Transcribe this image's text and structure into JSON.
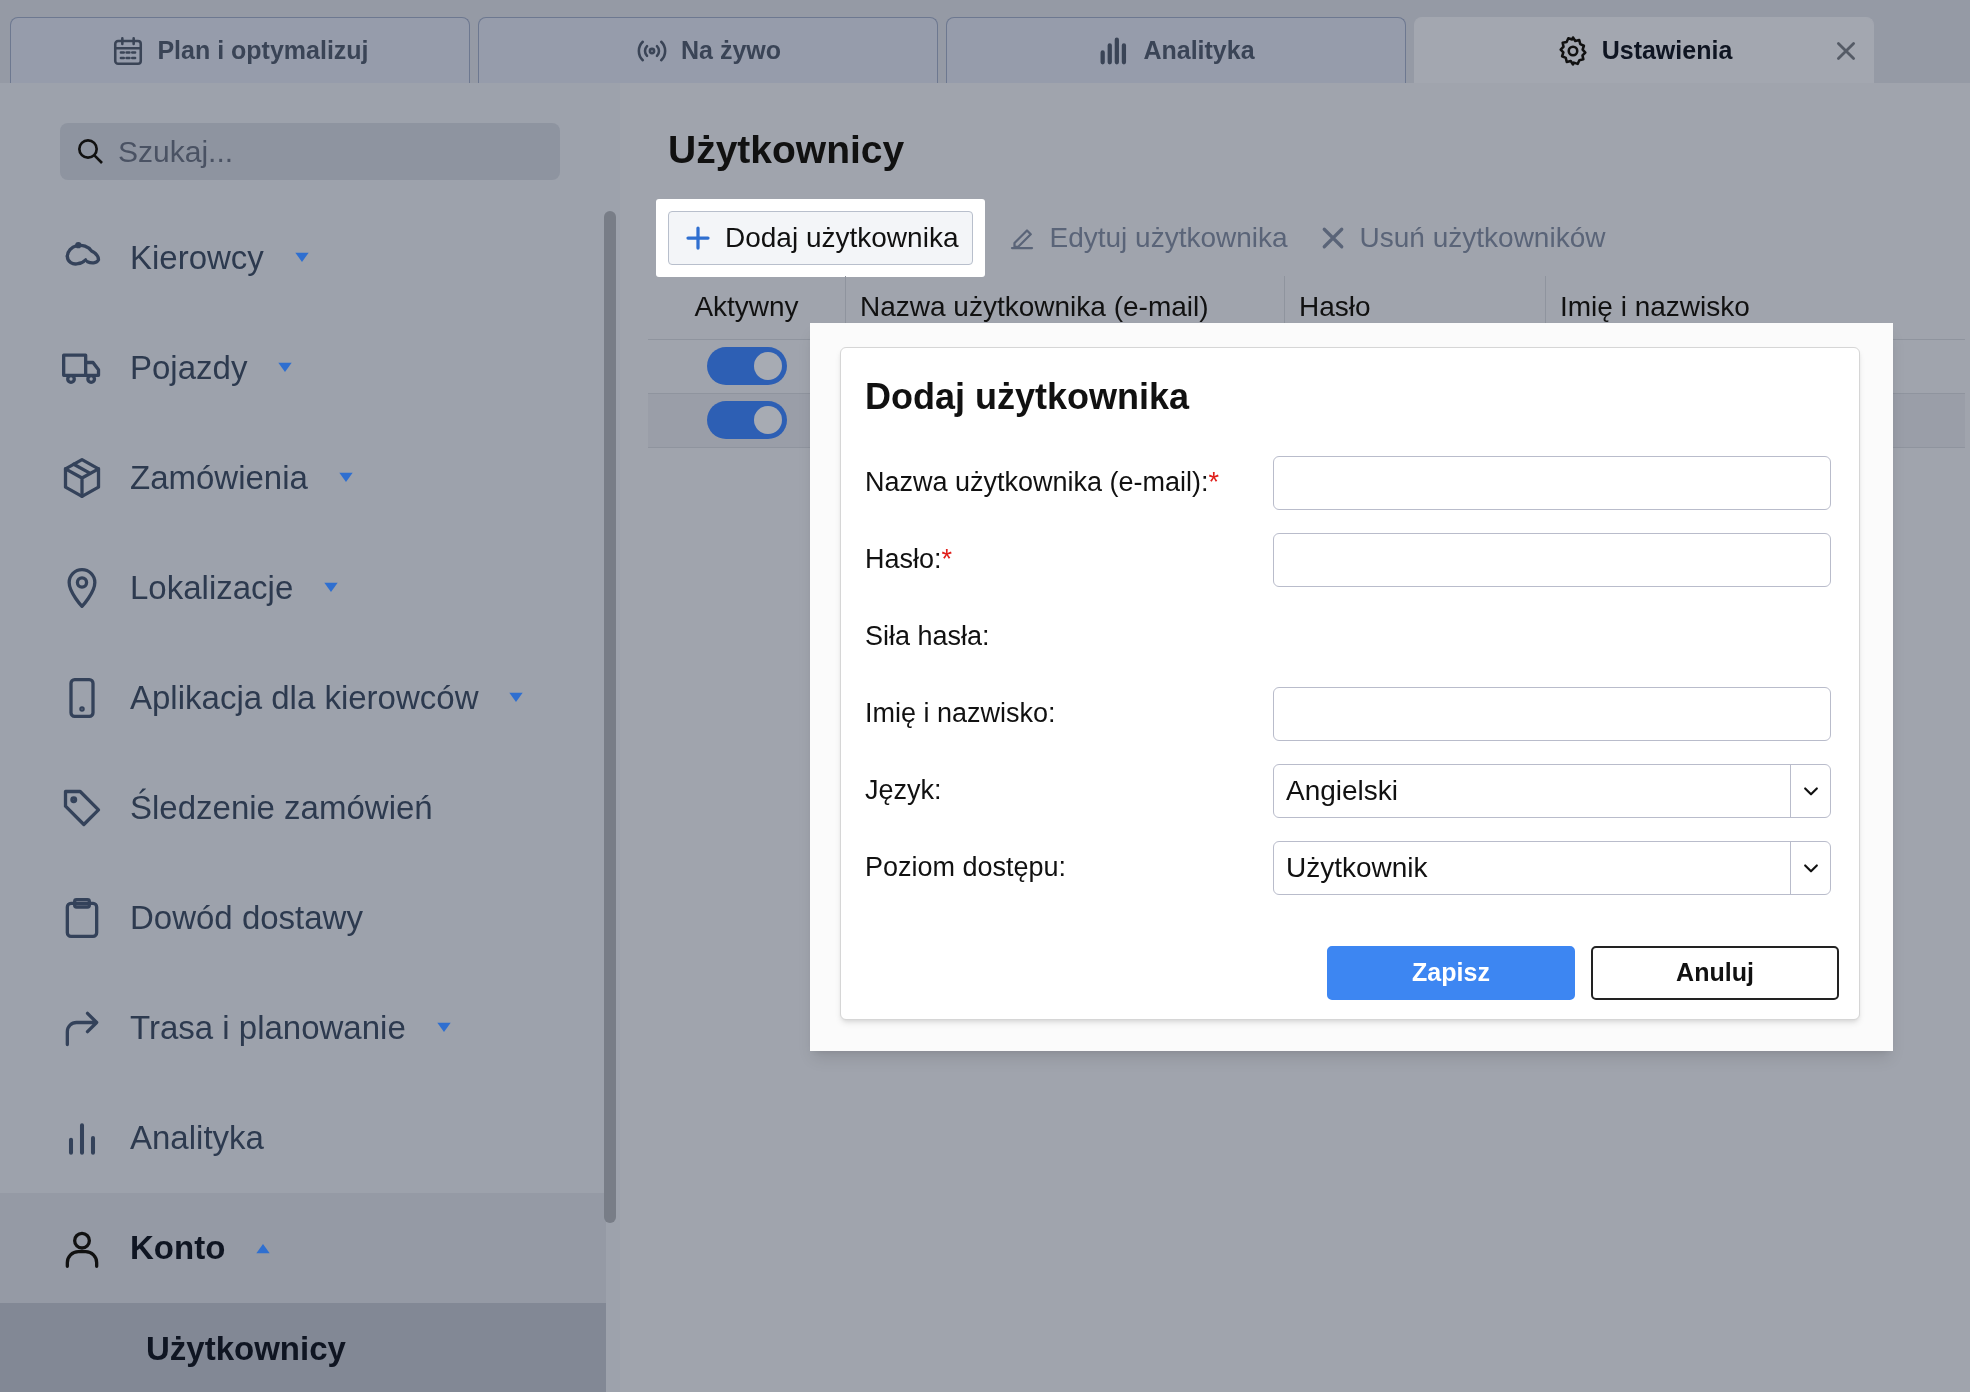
{
  "tabs": [
    {
      "label": "Plan i optymalizuj",
      "selected": false
    },
    {
      "label": "Na żywo",
      "selected": false
    },
    {
      "label": "Analityka",
      "selected": false
    },
    {
      "label": "Ustawienia",
      "selected": true
    }
  ],
  "sidebar": {
    "search": {
      "placeholder": "Szukaj..."
    },
    "items": [
      {
        "label": "Kierowcy",
        "expanded": false,
        "selected": false
      },
      {
        "label": "Pojazdy",
        "expanded": false,
        "selected": false
      },
      {
        "label": "Zamówienia",
        "expanded": false,
        "selected": false
      },
      {
        "label": "Lokalizacje",
        "expanded": false,
        "selected": false
      },
      {
        "label": "Aplikacja dla kierowców",
        "expanded": false,
        "selected": false
      },
      {
        "label": "Śledzenie zamówień",
        "selected": false
      },
      {
        "label": "Dowód dostawy",
        "selected": false
      },
      {
        "label": "Trasa i planowanie",
        "expanded": false,
        "selected": false
      },
      {
        "label": "Analityka",
        "selected": false
      },
      {
        "label": "Konto",
        "expanded": true,
        "selected": true,
        "children": [
          {
            "label": "Użytkownicy",
            "selected": true
          }
        ]
      }
    ]
  },
  "page_title": "Użytkownicy",
  "toolbar": [
    {
      "label": "Dodaj użytkownika",
      "disabled": false
    },
    {
      "label": "Edytuj użytkownika",
      "disabled": true
    },
    {
      "label": "Usuń użytkowników",
      "disabled": true
    }
  ],
  "table": {
    "columns": [
      "Aktywny",
      "Nazwa użytkownika (e-mail)",
      "Hasło",
      "Imię i nazwisko"
    ],
    "rows": [
      {
        "active": true
      },
      {
        "active": true
      }
    ]
  },
  "dialog": {
    "title": "Dodaj użytkownika",
    "fields": [
      {
        "label": "Nazwa użytkownika (e-mail):",
        "mark": "*",
        "kind": "text"
      },
      {
        "label": "Hasło:",
        "mark": "*",
        "kind": "text"
      },
      {
        "label": "Siła hasła:",
        "kind": "none"
      },
      {
        "label": "Imię i nazwisko:",
        "kind": "text"
      },
      {
        "label": "Język:",
        "kind": "select",
        "value": "Angielski"
      },
      {
        "label": "Poziom dostępu:",
        "kind": "select",
        "value": "Użytkownik"
      }
    ],
    "buttons": [
      {
        "label": "Zapisz",
        "kind": "primary"
      },
      {
        "label": "Anuluj",
        "kind": "secondary"
      }
    ]
  }
}
